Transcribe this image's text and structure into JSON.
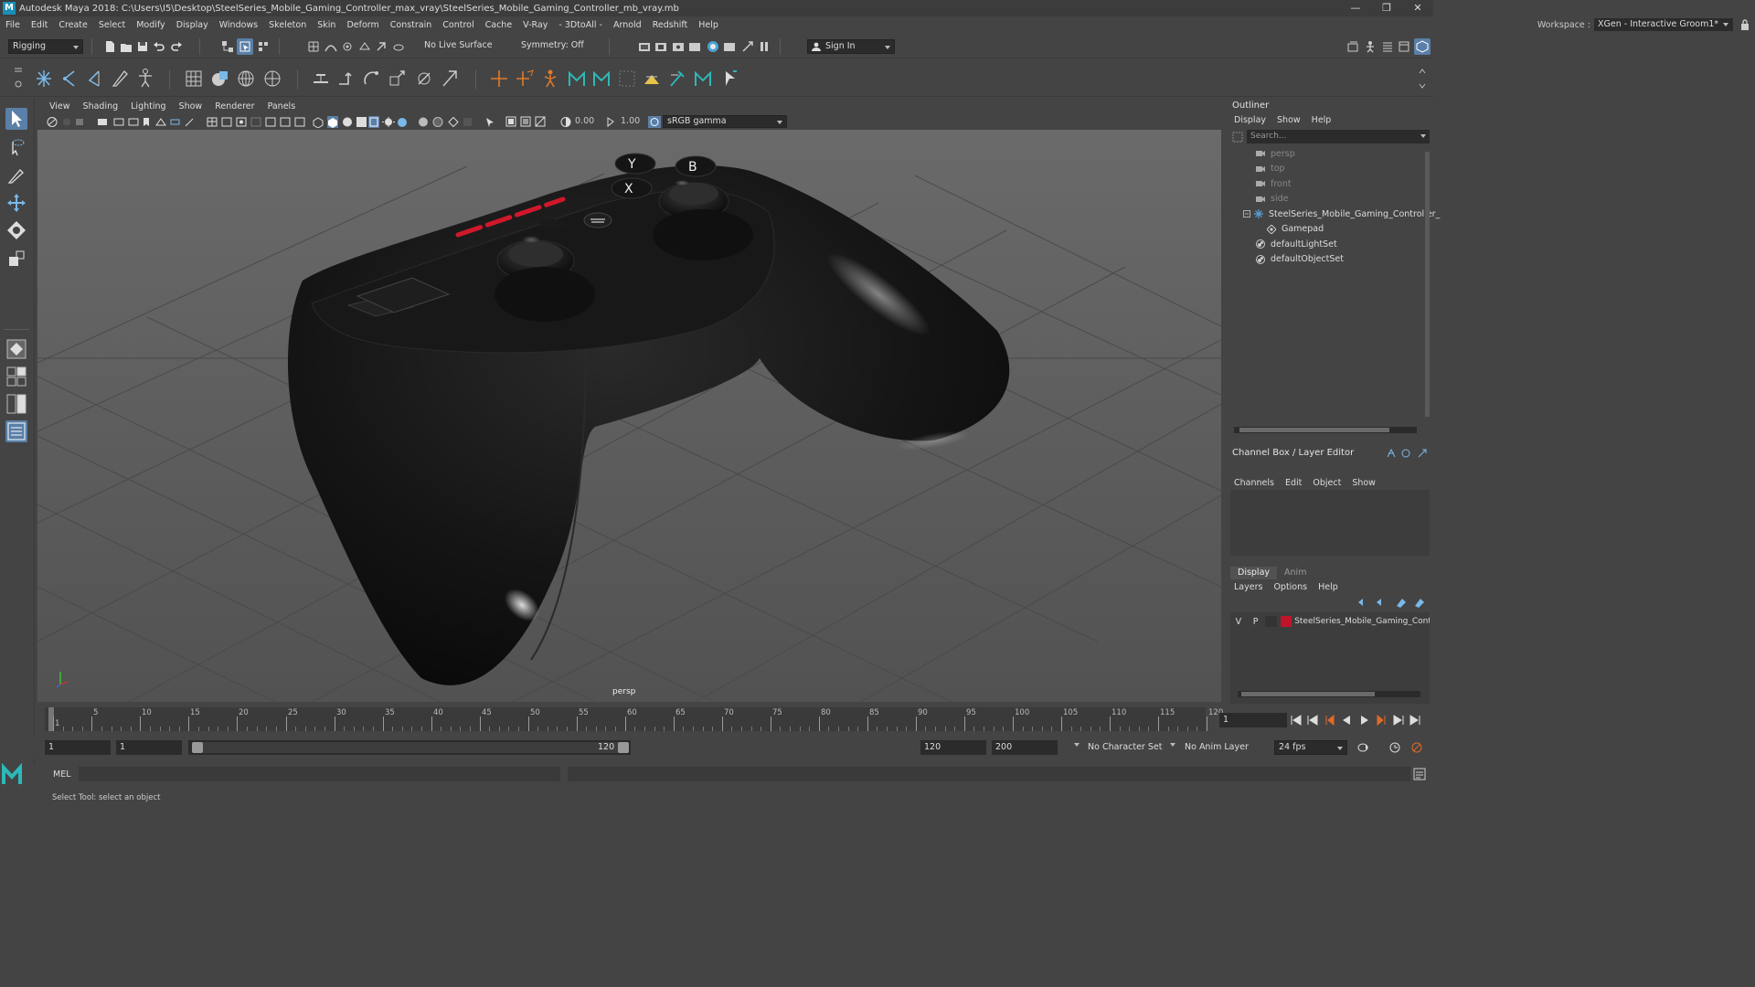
{
  "window": {
    "title": "Autodesk Maya 2018: C:\\Users\\I5\\Desktop\\SteelSeries_Mobile_Gaming_Controller_max_vray\\SteelSeries_Mobile_Gaming_Controller_mb_vray.mb",
    "controls": [
      "—",
      "❐",
      "✕"
    ]
  },
  "menubar": [
    "File",
    "Edit",
    "Create",
    "Select",
    "Modify",
    "Display",
    "Windows",
    "Skeleton",
    "Skin",
    "Deform",
    "Constrain",
    "Control",
    "Cache",
    "V-Ray",
    "- 3DtoAll -",
    "Arnold",
    "Redshift",
    "Help"
  ],
  "workspace": {
    "label": "Workspace :",
    "value": "XGen - Interactive Groom1*"
  },
  "statusline": {
    "mode": "Rigging",
    "live_surface": "No Live Surface",
    "symmetry": "Symmetry: Off",
    "sign_in": "Sign In"
  },
  "viewport": {
    "menu": [
      "View",
      "Shading",
      "Lighting",
      "Show",
      "Renderer",
      "Panels"
    ],
    "exposure": "0.00",
    "gamma": "1.00",
    "color_space": "sRGB gamma",
    "camera_label": "persp"
  },
  "outliner": {
    "title": "Outliner",
    "menu": [
      "Display",
      "Show",
      "Help"
    ],
    "search_placeholder": "Search...",
    "items": [
      {
        "label": "persp",
        "icon": "camera-icon",
        "dim": true,
        "indent": 0
      },
      {
        "label": "top",
        "icon": "camera-icon",
        "dim": true,
        "indent": 0
      },
      {
        "label": "front",
        "icon": "camera-icon",
        "dim": true,
        "indent": 0
      },
      {
        "label": "side",
        "icon": "camera-icon",
        "dim": true,
        "indent": 0
      },
      {
        "label": "SteelSeries_Mobile_Gaming_Controller_",
        "icon": "group-icon",
        "dim": false,
        "indent": 0
      },
      {
        "label": "Gamepad",
        "icon": "mesh-icon",
        "dim": false,
        "indent": 1
      },
      {
        "label": "defaultLightSet",
        "icon": "set-icon",
        "dim": false,
        "indent": 0
      },
      {
        "label": "defaultObjectSet",
        "icon": "set-icon",
        "dim": false,
        "indent": 0
      }
    ]
  },
  "channel_box": {
    "title": "Channel Box / Layer Editor",
    "menu": [
      "Channels",
      "Edit",
      "Object",
      "Show"
    ]
  },
  "layer_editor": {
    "tabs": [
      "Display",
      "Anim"
    ],
    "menu": [
      "Layers",
      "Options",
      "Help"
    ],
    "layer": {
      "v": "V",
      "p": "P",
      "name": "SteelSeries_Mobile_Gaming_Cont",
      "color": "#c0142a"
    }
  },
  "timeline": {
    "ticks": [
      "1",
      "5",
      "10",
      "15",
      "20",
      "25",
      "30",
      "35",
      "40",
      "45",
      "50",
      "55",
      "60",
      "65",
      "70",
      "75",
      "80",
      "85",
      "90",
      "95",
      "100",
      "105",
      "110",
      "115",
      "120"
    ],
    "current_frame": "1"
  },
  "range": {
    "start": "1",
    "playback_start": "1",
    "slider_start": "1",
    "slider_end": "120",
    "playback_end": "120",
    "end": "200",
    "character_set": "No Character Set",
    "anim_layer": "No Anim Layer",
    "fps": "24 fps"
  },
  "cmdline": {
    "label": "MEL"
  },
  "helpline": {
    "text": "Select Tool: select an object"
  },
  "colors": {
    "accent": "#5aa0d8",
    "bg": "#444444",
    "field": "#2b2b2b",
    "viewport": "#5e5e5e"
  }
}
